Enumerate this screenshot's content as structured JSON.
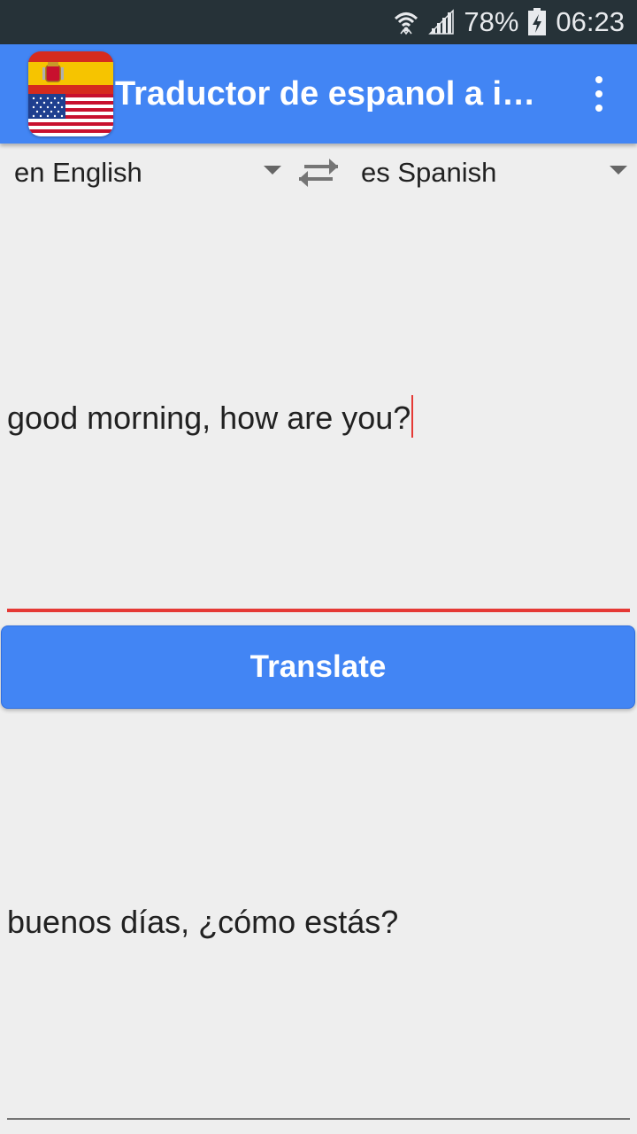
{
  "status_bar": {
    "battery": "78%",
    "time": "06:23",
    "icons": [
      "wifi-icon",
      "signal-icon",
      "battery-charging-icon"
    ]
  },
  "app_bar": {
    "title": "Traductor de espanol a inglés",
    "logo": "spain-usa-flags-logo",
    "menu_icon": "more-vert-icon",
    "color": "#4285f4"
  },
  "languages": {
    "source": "en English",
    "target": "es Spanish",
    "swap_icon": "swap-arrows-icon"
  },
  "input": {
    "value": "good morning, how are you?",
    "underline_color": "#e53935"
  },
  "translate_button": {
    "label": "Translate",
    "color": "#4285f4"
  },
  "output": {
    "value": "buenos días, ¿cómo estás?"
  }
}
